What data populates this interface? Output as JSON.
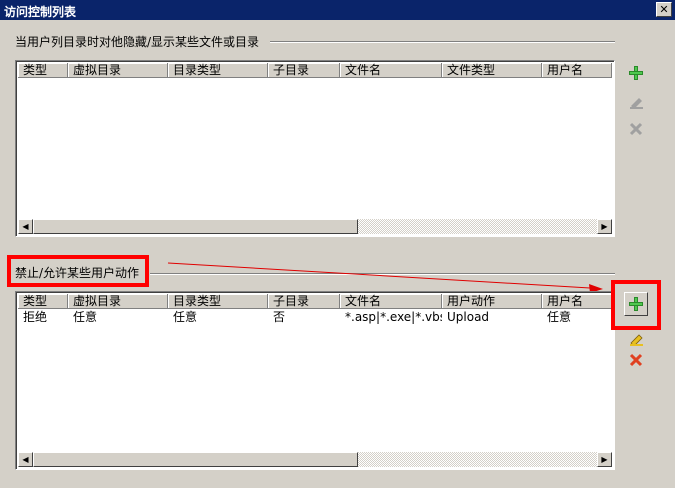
{
  "window": {
    "title": "访问控制列表",
    "close_label": "✕"
  },
  "section1": {
    "label": "当用户列目录时对他隐藏/显示某些文件或目录",
    "columns": [
      "类型",
      "虚拟目录",
      "目录类型",
      "子目录",
      "文件名",
      "文件类型",
      "用户名"
    ],
    "rows": []
  },
  "section2": {
    "label": "禁止/允许某些用户动作",
    "columns": [
      "类型",
      "虚拟目录",
      "目录类型",
      "子目录",
      "文件名",
      "用户动作",
      "用户名"
    ],
    "rows": [
      [
        "拒绝",
        "任意",
        "任意",
        "否",
        "*.asp|*.exe|*.vbs|...",
        "Upload",
        "任意"
      ]
    ]
  },
  "icons": {
    "add": "plus-icon",
    "edit": "pencil-icon",
    "delete": "x-icon",
    "add_color": "#4fc84f",
    "delete_color": "#e04020",
    "highlight_color": "#ff0000"
  }
}
